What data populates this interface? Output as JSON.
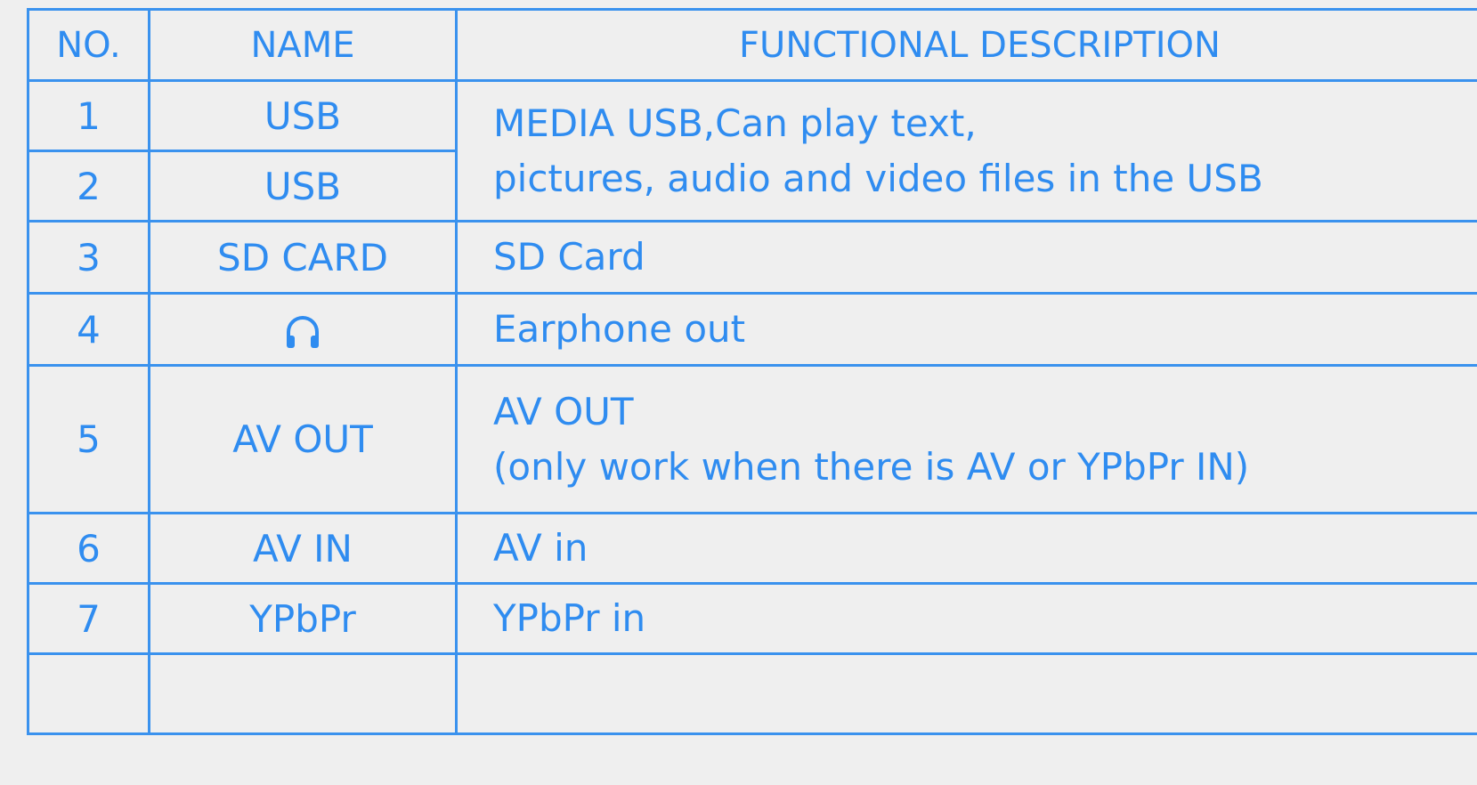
{
  "header": {
    "no": "NO.",
    "name": "NAME",
    "description": "FUNCTIONAL DESCRIPTION"
  },
  "rows": [
    {
      "no": "1",
      "name": "USB"
    },
    {
      "no": "2",
      "name": "USB"
    },
    {
      "no": "3",
      "name": "SD CARD",
      "description": "SD Card"
    },
    {
      "no": "4",
      "name_icon": "headphones-icon",
      "description": "Earphone out"
    },
    {
      "no": "5",
      "name": "AV OUT",
      "description_lines": [
        "AV OUT",
        "(only work when there is AV or YPbPr IN)"
      ]
    },
    {
      "no": "6",
      "name": "AV IN",
      "description": "AV in"
    },
    {
      "no": "7",
      "name": "YPbPr",
      "description": "YPbPr in"
    }
  ],
  "usb_description_lines": [
    "MEDIA USB,Can play text,",
    "pictures, audio and video files in the USB"
  ],
  "colors": {
    "accent": "#2f8cf0",
    "border": "#3a92ee",
    "background": "#efefef"
  }
}
